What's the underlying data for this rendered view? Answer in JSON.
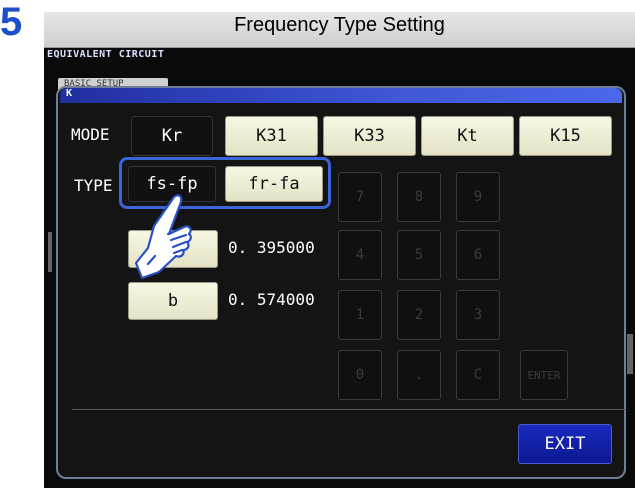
{
  "step_number": "5",
  "header": {
    "title": "Frequency Type Setting"
  },
  "screen": {
    "equiv_label": "EQUIVALENT CIRCUIT",
    "basic_tab_label": "BASIC SETUP"
  },
  "dialog": {
    "title": "K",
    "mode": {
      "label": "MODE",
      "options": [
        "Kr",
        "K31",
        "K33",
        "Kt",
        "K15"
      ],
      "selected": "Kr"
    },
    "type": {
      "label": "TYPE",
      "options": [
        "fs-fp",
        "fr-fa"
      ],
      "selected": "fs-fp"
    },
    "params": [
      {
        "label": "",
        "value": "0. 395000"
      },
      {
        "label": "b",
        "value": "0. 574000"
      }
    ],
    "keypad": [
      "7",
      "8",
      "9",
      "4",
      "5",
      "6",
      "1",
      "2",
      "3",
      "0",
      ".",
      "C",
      "ENTER"
    ],
    "exit_label": "EXIT"
  },
  "colors": {
    "step_number": "#1a50c8",
    "titlebar": "#3f57d8",
    "highlight": "#3b64d8",
    "exit_button": "#1b2ac0"
  }
}
